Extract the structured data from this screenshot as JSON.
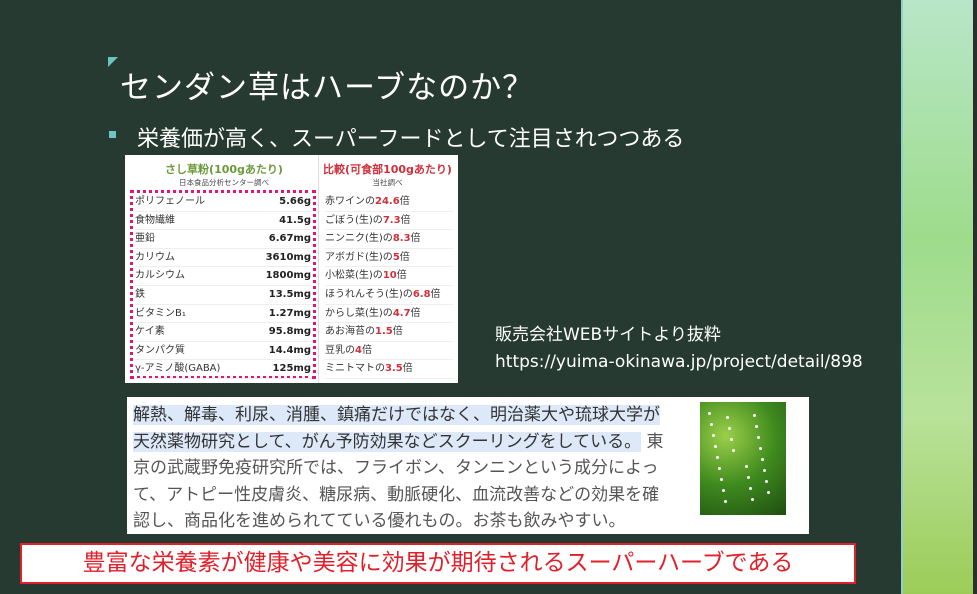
{
  "slide": {
    "title": "センダン草はハーブなのか？",
    "bullet": "栄養価が高く、スーパーフードとして注目されつつある",
    "table": {
      "left_header": "さし草粉(100gあたり)",
      "left_sub": "日本食品分析センター調べ",
      "right_header": "比較(可食部100gあたり)",
      "right_sub": "当社調べ",
      "rows": [
        {
          "name": "ポリフェノール",
          "value": "5.66g",
          "cmp": "赤ワインの",
          "mult": "24.6",
          "unit": "倍"
        },
        {
          "name": "食物繊維",
          "value": "41.5g",
          "cmp": "ごぼう(生)の",
          "mult": "7.3",
          "unit": "倍"
        },
        {
          "name": "亜鉛",
          "value": "6.67mg",
          "cmp": "ニンニク(生)の",
          "mult": "8.3",
          "unit": "倍"
        },
        {
          "name": "カリウム",
          "value": "3610mg",
          "cmp": "アボガド(生)の",
          "mult": "5",
          "unit": "倍"
        },
        {
          "name": "カルシウム",
          "value": "1800mg",
          "cmp": "小松菜(生)の",
          "mult": "10",
          "unit": "倍"
        },
        {
          "name": "鉄",
          "value": "13.5mg",
          "cmp": "ほうれんそう(生)の",
          "mult": "6.8",
          "unit": "倍"
        },
        {
          "name": "ビタミンB₁",
          "value": "1.27mg",
          "cmp": "からし菜(生)の",
          "mult": "4.7",
          "unit": "倍"
        },
        {
          "name": "ケイ素",
          "value": "95.8mg",
          "cmp": "あお海苔の",
          "mult": "1.5",
          "unit": "倍"
        },
        {
          "name": "タンパク質",
          "value": "14.4mg",
          "cmp": "豆乳の",
          "mult": "4",
          "unit": "倍"
        },
        {
          "name": "γ-アミノ酸(GABA)",
          "value": "125mg",
          "cmp": "ミニトマトの",
          "mult": "3.5",
          "unit": "倍"
        }
      ]
    },
    "source_label": "販売会社WEBサイトより抜粋",
    "source_url": "https://yuima-okinawa.jp/project/detail/898",
    "desc_highlight": "解熱、解毒、利尿、消腫、鎮痛だけではなく、明治薬大や琉球大学が天然薬物研究として、がん予防効果などスクーリングをしている。",
    "desc_rest": "東京の武蔵野免疫研究所では、フライボン、タンニンという成分によって、アトピー性皮膚炎、糖尿病、動脈硬化、血流改善などの効果を確認し、商品化を進められてている優れもの。お茶も飲みやすい。",
    "conclusion": "豊富な栄養素が健康や美容に効果が期待されるスーパーハーブである",
    "colors": {
      "background": "#263a31",
      "accent": "#6cc5c0",
      "highlight_red": "#e0202a",
      "dotted_pink": "#e0157a"
    }
  }
}
